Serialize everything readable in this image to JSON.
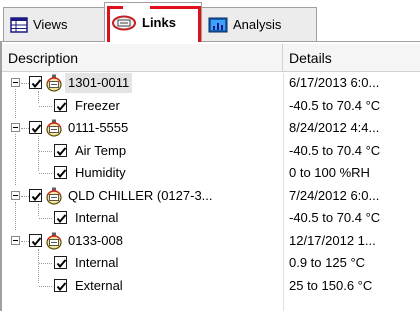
{
  "tabs": [
    {
      "label": "Views",
      "icon": "views-grid-icon"
    },
    {
      "label": "Links",
      "icon": "logger-link-icon",
      "active": true
    },
    {
      "label": "Analysis",
      "icon": "analysis-chart-icon"
    }
  ],
  "columns": {
    "description": "Description",
    "details": "Details"
  },
  "tree": [
    {
      "label": "1301-0011",
      "details": "6/17/2013 6:0...",
      "selected": true,
      "children": [
        {
          "label": "Freezer",
          "details": "-40.5 to 70.4 °C"
        }
      ]
    },
    {
      "label": "0111-5555",
      "details": "8/24/2012 4:4...",
      "children": [
        {
          "label": "Air Temp",
          "details": "-40.5 to 70.4 °C"
        },
        {
          "label": "Humidity",
          "details": "0 to 100 %RH"
        }
      ]
    },
    {
      "label": "QLD CHILLER (0127-3...",
      "details": "7/24/2012 6:0...",
      "children": [
        {
          "label": "Internal",
          "details": "-40.5 to 70.4 °C"
        }
      ]
    },
    {
      "label": "0133-008",
      "details": "12/17/2012 1...",
      "children": [
        {
          "label": "Internal",
          "details": "0.9 to 125 °C"
        },
        {
          "label": "External",
          "details": "25 to 150.6 °C"
        }
      ]
    }
  ],
  "colors": {
    "annotation": "#e0101a",
    "selection": "#e4e4e4",
    "device_red": "#d42020"
  }
}
